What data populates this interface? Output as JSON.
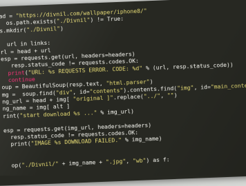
{
  "editor": {
    "lines": [
      [
        {
          "t": "ad = ",
          "c": "pl"
        },
        {
          "t": "\"https://divnil.com/wallpaper/iphone8/\"",
          "c": "str"
        }
      ],
      [
        {
          "t": "  os.path.exists(",
          "c": "pl"
        },
        {
          "t": "\"./Divnil\"",
          "c": "str"
        },
        {
          "t": ") != True:",
          "c": "pl"
        }
      ],
      [
        {
          "t": "s.mkdir(",
          "c": "pl"
        },
        {
          "t": "\"./Divnil\"",
          "c": "str"
        },
        {
          "t": ")",
          "c": "pl"
        }
      ],
      [
        {
          "t": "",
          "c": "pl"
        }
      ],
      [
        {
          "t": "  url in links:",
          "c": "pl"
        }
      ],
      [
        {
          "t": "rl = head + url",
          "c": "pl"
        }
      ],
      [
        {
          "t": "esp = requests.get(url, headers=headers)",
          "c": "pl"
        }
      ],
      [
        {
          "t": "   resp.status_code != requests.codes.OK:",
          "c": "pl"
        }
      ],
      [
        {
          "t": "  print",
          "c": "kw"
        },
        {
          "t": "(",
          "c": "pl"
        },
        {
          "t": "\"URL: %s REQUESTS ERROR. CODE: %d\"",
          "c": "str"
        },
        {
          "t": " % (url, resp.status_code))",
          "c": "pl"
        }
      ],
      [
        {
          "t": "  continue",
          "c": "kw"
        }
      ],
      [
        {
          "t": "oup = BeautifulSoup(resp.text, ",
          "c": "pl"
        },
        {
          "t": "\"html.parser\"",
          "c": "str"
        },
        {
          "t": ")",
          "c": "pl"
        }
      ],
      [
        {
          "t": "mg = ",
          "c": "pl"
        },
        {
          "t": " soup.find(",
          "c": "pl"
        },
        {
          "t": "\"div\"",
          "c": "str"
        },
        {
          "t": ", id=",
          "c": "pl"
        },
        {
          "t": "\"contents\"",
          "c": "str"
        },
        {
          "t": ").contents.find(",
          "c": "pl"
        },
        {
          "t": "\"img\"",
          "c": "str"
        },
        {
          "t": ", id=",
          "c": "pl"
        },
        {
          "t": "\"main_content\"",
          "c": "str"
        }
      ],
      [
        {
          "t": "ng_url = head + img[ ",
          "c": "pl"
        },
        {
          "t": "\"original ]\"",
          "c": "str"
        },
        {
          "t": ".replace(",
          "c": "pl"
        },
        {
          "t": "\"../\"",
          "c": "str"
        },
        {
          "t": ", ",
          "c": "pl"
        },
        {
          "t": "\"\"",
          "c": "str"
        },
        {
          "t": ")",
          "c": "pl"
        }
      ],
      [
        {
          "t": "ng_name = img[ alt ]",
          "c": "pl"
        }
      ],
      [
        {
          "t": "rint(",
          "c": "pl"
        },
        {
          "t": "\"start download %s ...\"",
          "c": "str"
        },
        {
          "t": " % img_url)",
          "c": "pl"
        }
      ],
      [
        {
          "t": "",
          "c": "pl"
        }
      ],
      [
        {
          "t": "esp = requests.get(img_url, headers=headers)",
          "c": "pl"
        }
      ],
      [
        {
          "t": "  resp.status_code != requests.codes.OK:",
          "c": "pl"
        }
      ],
      [
        {
          "t": "  print(",
          "c": "pl"
        },
        {
          "t": "\"IMAGE %s DOWNLOAD FAILED.\"",
          "c": "str"
        },
        {
          "t": " % img_name)",
          "c": "pl"
        }
      ],
      [
        {
          "t": "",
          "c": "pl"
        }
      ],
      [
        {
          "t": "",
          "c": "pl"
        }
      ],
      [
        {
          "t": "  op(",
          "c": "pl"
        },
        {
          "t": "\"./Divnil/\"",
          "c": "str"
        },
        {
          "t": " + img_name + ",
          "c": "pl"
        },
        {
          "t": "\".jpg\"",
          "c": "str"
        },
        {
          "t": ", ",
          "c": "pl"
        },
        {
          "t": "\"wb\"",
          "c": "str"
        },
        {
          "t": ") as f:",
          "c": "pl"
        }
      ]
    ]
  },
  "colors": {
    "background": "#272822",
    "string": "#e6db74",
    "keyword": "#f92672",
    "text": "#f8f8f2"
  }
}
